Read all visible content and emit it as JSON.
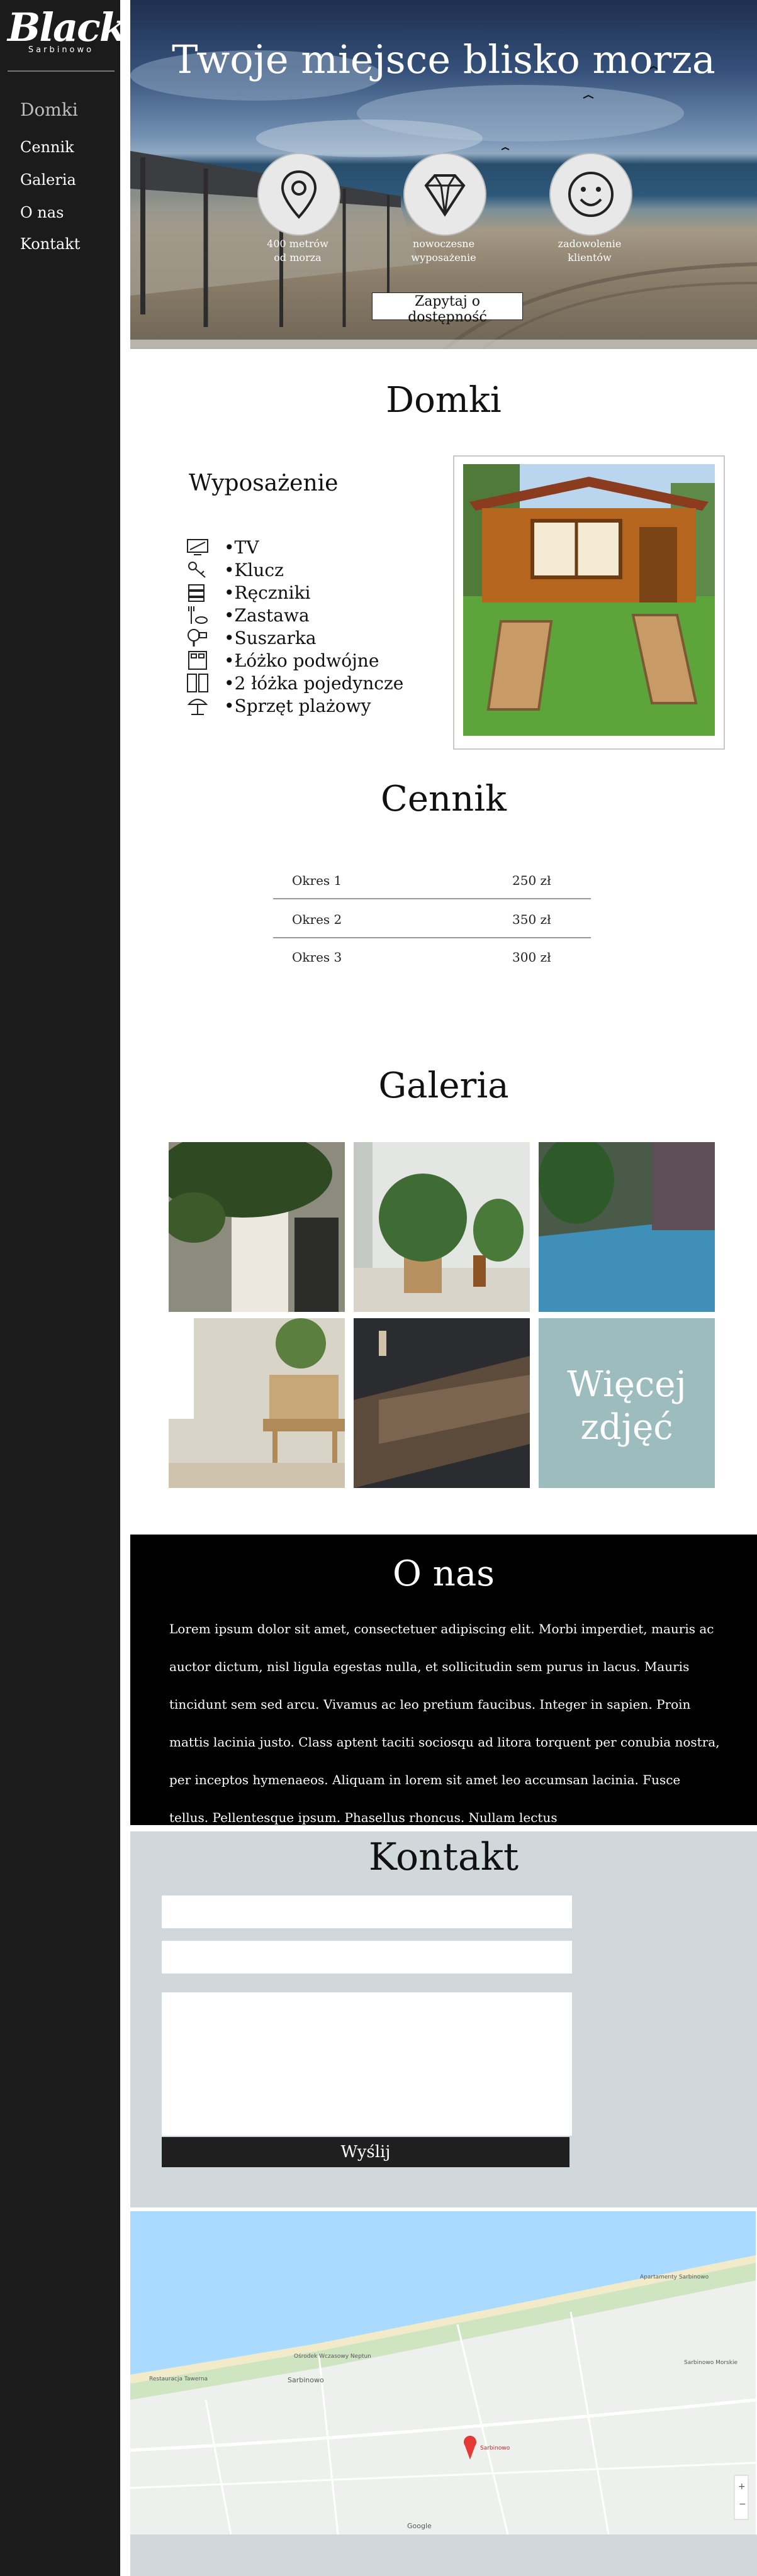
{
  "brand": {
    "script": "Black",
    "sub": "Sarbinowo"
  },
  "nav": {
    "items": [
      {
        "label": "Domki"
      },
      {
        "label": "Cennik"
      },
      {
        "label": "Galeria"
      },
      {
        "label": "O nas"
      },
      {
        "label": "Kontakt"
      }
    ]
  },
  "hero": {
    "title": "Twoje miejsce blisko morza",
    "features": [
      {
        "icon": "location-pin-icon",
        "caption_line1": "400 metrów",
        "caption_line2": "od morza"
      },
      {
        "icon": "diamond-icon",
        "caption_line1": "nowoczesne",
        "caption_line2": "wyposażenie"
      },
      {
        "icon": "smiley-icon",
        "caption_line1": "zadowolenie",
        "caption_line2": "klientów"
      }
    ],
    "cta_label": "Zapytaj o dostępność"
  },
  "domki": {
    "title": "Domki",
    "equipment_title": "Wyposażenie",
    "equipment": [
      {
        "icon": "tv-icon",
        "label": "•TV"
      },
      {
        "icon": "key-icon",
        "label": "•Klucz"
      },
      {
        "icon": "towel-icon",
        "label": "•Ręczniki"
      },
      {
        "icon": "tableware-icon",
        "label": "•Zastawa"
      },
      {
        "icon": "hairdryer-icon",
        "label": "•Suszarka"
      },
      {
        "icon": "double-bed-icon",
        "label": "•Łóżko podwójne"
      },
      {
        "icon": "single-bed-icon",
        "label": "•2 łóżka pojedyncze"
      },
      {
        "icon": "beach-umbrella-icon",
        "label": "•Sprzęt plażowy"
      }
    ]
  },
  "cennik": {
    "title": "Cennik",
    "rows": [
      {
        "period": "Okres 1",
        "price": "250 zł"
      },
      {
        "period": "Okres 2",
        "price": "350 zł"
      },
      {
        "period": "Okres 3",
        "price": "300 zł"
      }
    ]
  },
  "galeria": {
    "title": "Galeria",
    "more_line1": "Więcej",
    "more_line2": "zdjęć"
  },
  "about": {
    "title": "O nas",
    "text": "Lorem ipsum dolor sit amet, consectetuer adipiscing elit. Morbi imperdiet, mauris ac auctor dictum, nisl ligula egestas nulla, et sollicitudin sem purus in lacus. Mauris tincidunt sem sed arcu. Vivamus ac leo pretium faucibus. Integer in sapien. Proin mattis lacinia justo. Class aptent taciti sociosqu ad litora torquent per conubia nostra, per inceptos hymenaeos. Aliquam in lorem sit amet leo accumsan lacinia. Fusce tellus. Pellentesque ipsum. Phasellus rhoncus. Nullam lectus"
  },
  "contact": {
    "title": "Kontakt",
    "name_placeholder": "",
    "email_placeholder": "",
    "message_placeholder": "",
    "send_label": "Wyślij"
  },
  "map": {
    "place_label": "Sarbinowo",
    "pin_label": "Sarbinowo",
    "attribution": "Google",
    "labels": [
      "Ośrodek Wczasowy Neptun",
      "Apartamenty Sarbinowo",
      "Sarbinowo Morskie",
      "Restauracja Tawerna"
    ]
  },
  "colors": {
    "sidebar": "#1b1b1b",
    "accent_tile": "#9cbcbd",
    "contact_bg": "#d1d8dc",
    "about_bg": "#000000",
    "sea": "#aadaff"
  }
}
